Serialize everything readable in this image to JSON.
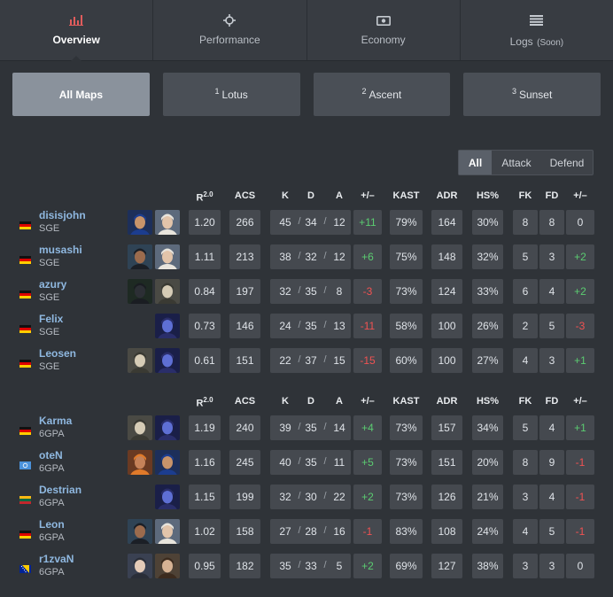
{
  "tabs": [
    {
      "label": "Overview",
      "icon": "bar-chart-icon",
      "active": true,
      "soon": ""
    },
    {
      "label": "Performance",
      "icon": "crosshair-icon",
      "active": false,
      "soon": ""
    },
    {
      "label": "Economy",
      "icon": "money-icon",
      "active": false,
      "soon": ""
    },
    {
      "label": "Logs",
      "icon": "list-icon",
      "active": false,
      "soon": "(Soon)"
    }
  ],
  "maps": [
    {
      "num": "",
      "label": "All Maps",
      "active": true
    },
    {
      "num": "1",
      "label": "Lotus",
      "active": false
    },
    {
      "num": "2",
      "label": "Ascent",
      "active": false
    },
    {
      "num": "3",
      "label": "Sunset",
      "active": false
    }
  ],
  "side_filter": [
    {
      "label": "All",
      "active": true
    },
    {
      "label": "Attack",
      "active": false
    },
    {
      "label": "Defend",
      "active": false
    }
  ],
  "columns": {
    "rating": "R",
    "rating_sup": "2.0",
    "acs": "ACS",
    "k": "K",
    "d": "D",
    "a": "A",
    "pm": "+/–",
    "kast": "KAST",
    "adr": "ADR",
    "hs": "HS%",
    "fk": "FK",
    "fd": "FD",
    "fpm": "+/–"
  },
  "kda_sep": "/",
  "teams": [
    {
      "name": "SGE",
      "players": [
        {
          "name": "disisjohn",
          "team": "SGE",
          "flag": "de",
          "agents": [
            "neon",
            "sova"
          ],
          "rating": "1.20",
          "acs": "266",
          "k": "45",
          "d": "34",
          "a": "12",
          "pm": "+11",
          "kast": "79%",
          "adr": "164",
          "hs": "30%",
          "fk": "8",
          "fd": "8",
          "fpm": "0"
        },
        {
          "name": "musashi",
          "team": "SGE",
          "flag": "de",
          "agents": [
            "harbor",
            "sova"
          ],
          "rating": "1.11",
          "acs": "213",
          "k": "38",
          "d": "32",
          "a": "12",
          "pm": "+6",
          "kast": "75%",
          "adr": "148",
          "hs": "32%",
          "fk": "5",
          "fd": "3",
          "fpm": "+2"
        },
        {
          "name": "azury",
          "team": "SGE",
          "flag": "de",
          "agents": [
            "viper",
            "fade"
          ],
          "rating": "0.84",
          "acs": "197",
          "k": "32",
          "d": "35",
          "a": "8",
          "pm": "-3",
          "kast": "73%",
          "adr": "124",
          "hs": "33%",
          "fk": "6",
          "fd": "4",
          "fpm": "+2"
        },
        {
          "name": "Felix",
          "team": "SGE",
          "flag": "de",
          "agents": [
            "omen"
          ],
          "rating": "0.73",
          "acs": "146",
          "k": "24",
          "d": "35",
          "a": "13",
          "pm": "-11",
          "kast": "58%",
          "adr": "100",
          "hs": "26%",
          "fk": "2",
          "fd": "5",
          "fpm": "-3"
        },
        {
          "name": "Leosen",
          "team": "SGE",
          "flag": "de",
          "agents": [
            "fade",
            "omen"
          ],
          "rating": "0.61",
          "acs": "151",
          "k": "22",
          "d": "37",
          "a": "15",
          "pm": "-15",
          "kast": "60%",
          "adr": "100",
          "hs": "27%",
          "fk": "4",
          "fd": "3",
          "fpm": "+1"
        }
      ]
    },
    {
      "name": "6GPA",
      "players": [
        {
          "name": "Karma",
          "team": "6GPA",
          "flag": "de",
          "agents": [
            "fade",
            "omen"
          ],
          "rating": "1.19",
          "acs": "240",
          "k": "39",
          "d": "35",
          "a": "14",
          "pm": "+4",
          "kast": "73%",
          "adr": "157",
          "hs": "34%",
          "fk": "5",
          "fd": "4",
          "fpm": "+1"
        },
        {
          "name": "oteN",
          "team": "6GPA",
          "flag": "un",
          "agents": [
            "phoenix",
            "neon"
          ],
          "rating": "1.16",
          "acs": "245",
          "k": "40",
          "d": "35",
          "a": "11",
          "pm": "+5",
          "kast": "73%",
          "adr": "151",
          "hs": "20%",
          "fk": "8",
          "fd": "9",
          "fpm": "-1"
        },
        {
          "name": "Destrian",
          "team": "6GPA",
          "flag": "lt",
          "agents": [
            "omen"
          ],
          "rating": "1.15",
          "acs": "199",
          "k": "32",
          "d": "30",
          "a": "22",
          "pm": "+2",
          "kast": "73%",
          "adr": "126",
          "hs": "21%",
          "fk": "3",
          "fd": "4",
          "fpm": "-1"
        },
        {
          "name": "Leon",
          "team": "6GPA",
          "flag": "de",
          "agents": [
            "harbor",
            "sova"
          ],
          "rating": "1.02",
          "acs": "158",
          "k": "27",
          "d": "28",
          "a": "16",
          "pm": "-1",
          "kast": "83%",
          "adr": "108",
          "hs": "24%",
          "fk": "4",
          "fd": "5",
          "fpm": "-1"
        },
        {
          "name": "r1zvaN",
          "team": "6GPA",
          "flag": "ba",
          "agents": [
            "jett",
            "chamber"
          ],
          "rating": "0.95",
          "acs": "182",
          "k": "35",
          "d": "33",
          "a": "5",
          "pm": "+2",
          "kast": "69%",
          "adr": "127",
          "hs": "38%",
          "fk": "3",
          "fd": "3",
          "fpm": "0"
        }
      ]
    }
  ],
  "colors": {
    "accent": "#e05c5c",
    "positive": "#5bcc71",
    "negative": "#f05252",
    "player_link": "#8fb8e0"
  }
}
